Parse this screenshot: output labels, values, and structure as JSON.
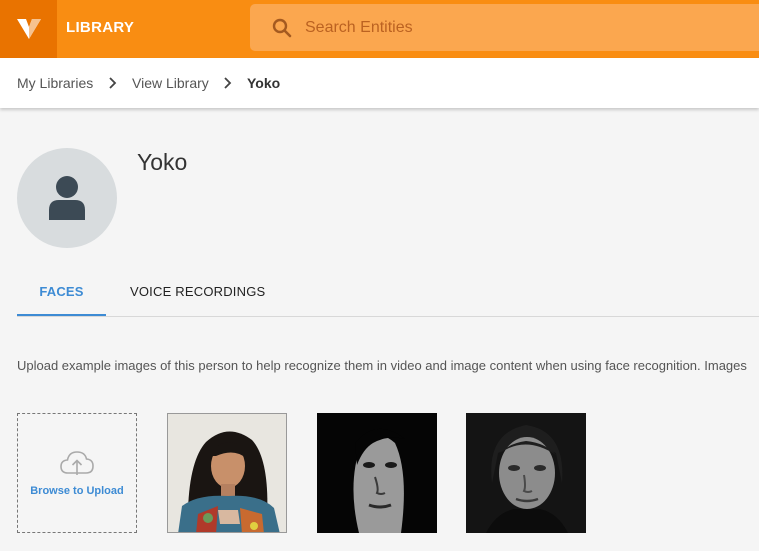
{
  "header": {
    "app_title": "LIBRARY",
    "logo_icon": "vidrovr-logo-icon",
    "search": {
      "placeholder": "Search Entities",
      "value": ""
    },
    "colors": {
      "bar": "#f98d12",
      "logo_bg": "#e97300",
      "search_bg": "#fba74f"
    }
  },
  "breadcrumb": {
    "items": [
      {
        "label": "My Libraries"
      },
      {
        "label": "View Library"
      },
      {
        "label": "Yoko"
      }
    ]
  },
  "entity": {
    "name": "Yoko",
    "avatar_icon": "person-icon"
  },
  "tabs": [
    {
      "label": "FACES",
      "active": true
    },
    {
      "label": "VOICE RECORDINGS",
      "active": false
    }
  ],
  "faces": {
    "description": "Upload example images of this person to help recognize them in video and image content when using face recognition. Images",
    "upload_label": "Browse to Upload",
    "upload_icon": "cloud-upload-icon",
    "images": [
      {
        "id": "face-1",
        "style": "color"
      },
      {
        "id": "face-2",
        "style": "black-and-white"
      },
      {
        "id": "face-3",
        "style": "black-and-white"
      }
    ]
  },
  "accent_color": "#3d8bd4"
}
